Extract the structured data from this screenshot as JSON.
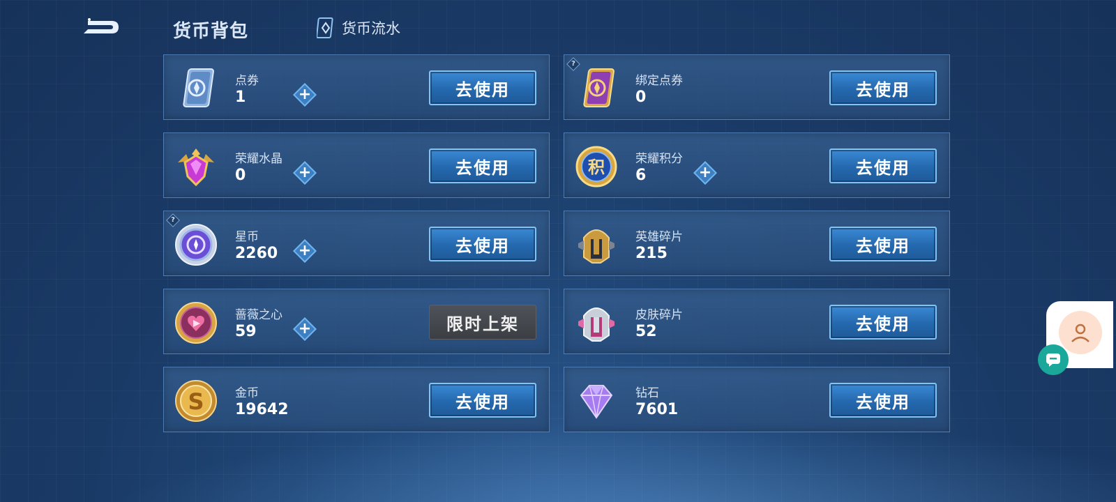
{
  "header": {
    "title": "货币背包",
    "flow_label": "货币流水"
  },
  "currencies": [
    {
      "name": "点券",
      "value": "1",
      "has_plus": true,
      "has_hint": false,
      "button": "去使用",
      "icon": "voucher-card-icon"
    },
    {
      "name": "绑定点券",
      "value": "0",
      "has_plus": false,
      "has_hint": true,
      "button": "去使用",
      "icon": "bound-voucher-card-icon"
    },
    {
      "name": "荣耀水晶",
      "value": "0",
      "has_plus": true,
      "has_hint": false,
      "button": "去使用",
      "icon": "glory-crystal-icon"
    },
    {
      "name": "荣耀积分",
      "value": "6",
      "has_plus": true,
      "has_hint": false,
      "button": "去使用",
      "icon": "glory-points-icon"
    },
    {
      "name": "星币",
      "value": "2260",
      "has_plus": true,
      "has_hint": true,
      "button": "去使用",
      "icon": "star-coin-icon"
    },
    {
      "name": "英雄碎片",
      "value": "215",
      "has_plus": false,
      "has_hint": false,
      "button": "去使用",
      "icon": "hero-fragment-icon"
    },
    {
      "name": "蔷薇之心",
      "value": "59",
      "has_plus": true,
      "has_hint": false,
      "button": "限时上架",
      "icon": "rose-heart-icon"
    },
    {
      "name": "皮肤碎片",
      "value": "52",
      "has_plus": false,
      "has_hint": false,
      "button": "去使用",
      "icon": "skin-fragment-icon"
    },
    {
      "name": "金币",
      "value": "19642",
      "has_plus": false,
      "has_hint": false,
      "button": "去使用",
      "icon": "gold-coin-icon"
    },
    {
      "name": "钻石",
      "value": "7601",
      "has_plus": false,
      "has_hint": false,
      "button": "去使用",
      "icon": "diamond-icon"
    }
  ],
  "symbols": {
    "plus": "+",
    "hint": "?",
    "glory_points_char": "积",
    "gold_coin_char": "S"
  },
  "colors": {
    "background": "#1a3a66",
    "card": "#2f5786",
    "button": "#2468ad",
    "button_border": "#7ec4f5",
    "limited_button": "#45494e",
    "chat_bubble": "#19a89a"
  }
}
